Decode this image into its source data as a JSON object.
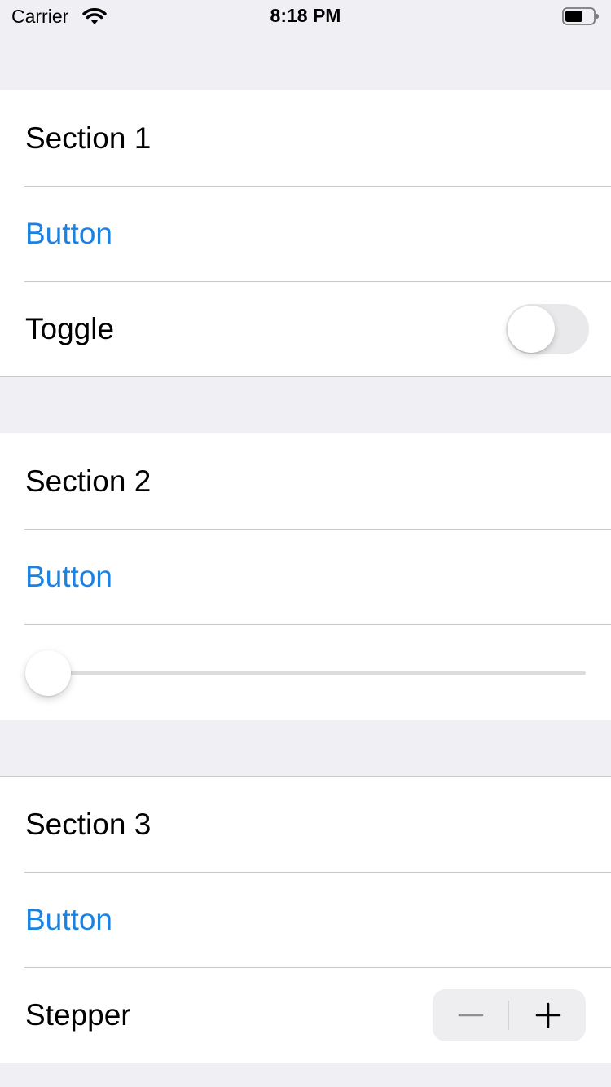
{
  "status_bar": {
    "carrier": "Carrier",
    "time": "8:18 PM",
    "wifi_icon": "wifi-icon",
    "battery_icon": "battery-icon"
  },
  "sections": [
    {
      "title": "Section 1",
      "button_label": "Button",
      "toggle": {
        "label": "Toggle",
        "on": false
      }
    },
    {
      "title": "Section 2",
      "button_label": "Button",
      "slider": {
        "value": 0
      }
    },
    {
      "title": "Section 3",
      "button_label": "Button",
      "stepper": {
        "label": "Stepper",
        "minus_icon": "minus-icon",
        "plus_icon": "plus-icon"
      }
    }
  ],
  "colors": {
    "accent": "#1a82e2",
    "background": "#efeff4",
    "separator": "#c8c7cc",
    "toggle_off": "#e9e9eb"
  }
}
